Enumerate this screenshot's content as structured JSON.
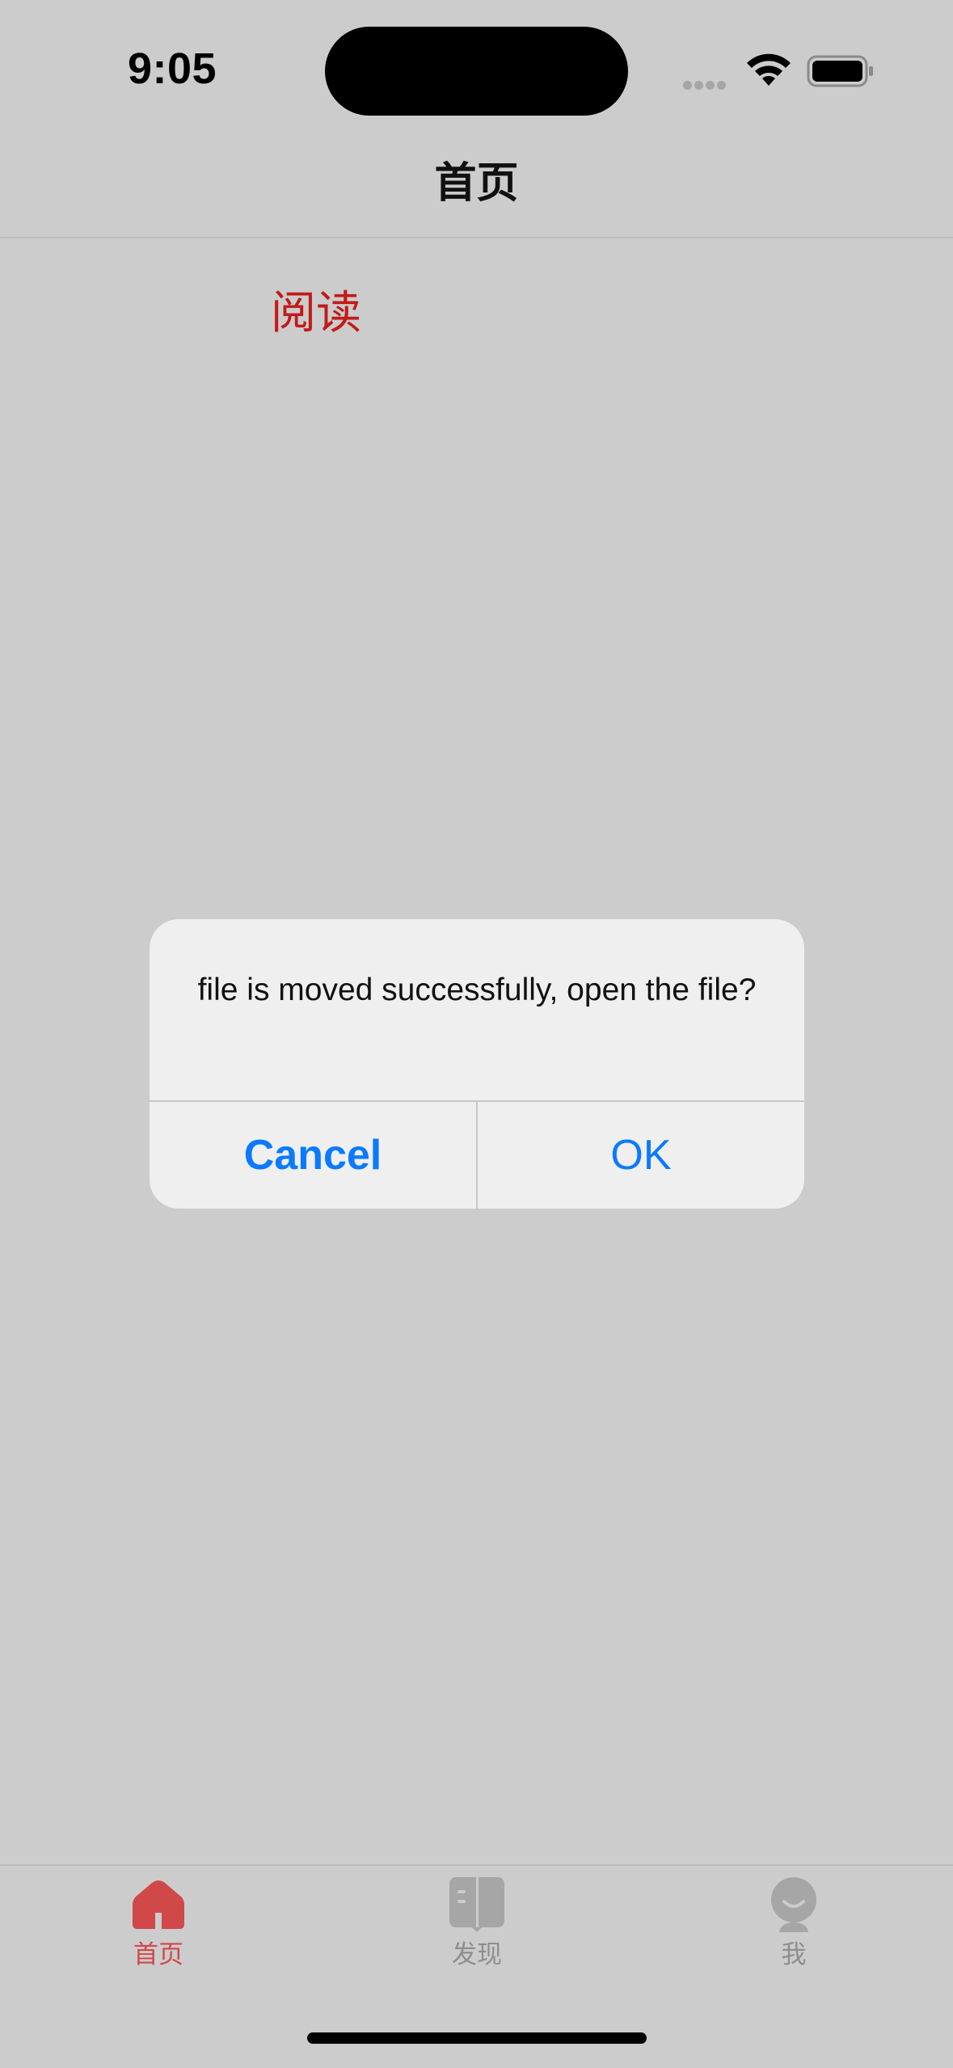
{
  "status_bar": {
    "time": "9:05",
    "icons": [
      "cellular-dots-icon",
      "wifi-icon",
      "battery-icon"
    ]
  },
  "nav": {
    "title": "首页"
  },
  "content": {
    "read_link": "阅读"
  },
  "alert": {
    "message": "file is moved successfully, open the file?",
    "cancel_label": "Cancel",
    "ok_label": "OK"
  },
  "tab_bar": {
    "items": [
      {
        "label": "首页",
        "icon": "home-icon",
        "active": true
      },
      {
        "label": "发现",
        "icon": "book-icon",
        "active": false
      },
      {
        "label": "我",
        "icon": "person-icon",
        "active": false
      }
    ]
  },
  "colors": {
    "background": "#cccccc",
    "accent_red": "#d14848",
    "link_red": "#c31a1a",
    "ios_blue": "#0a7aff",
    "inactive_gray": "#8e8e8e"
  }
}
